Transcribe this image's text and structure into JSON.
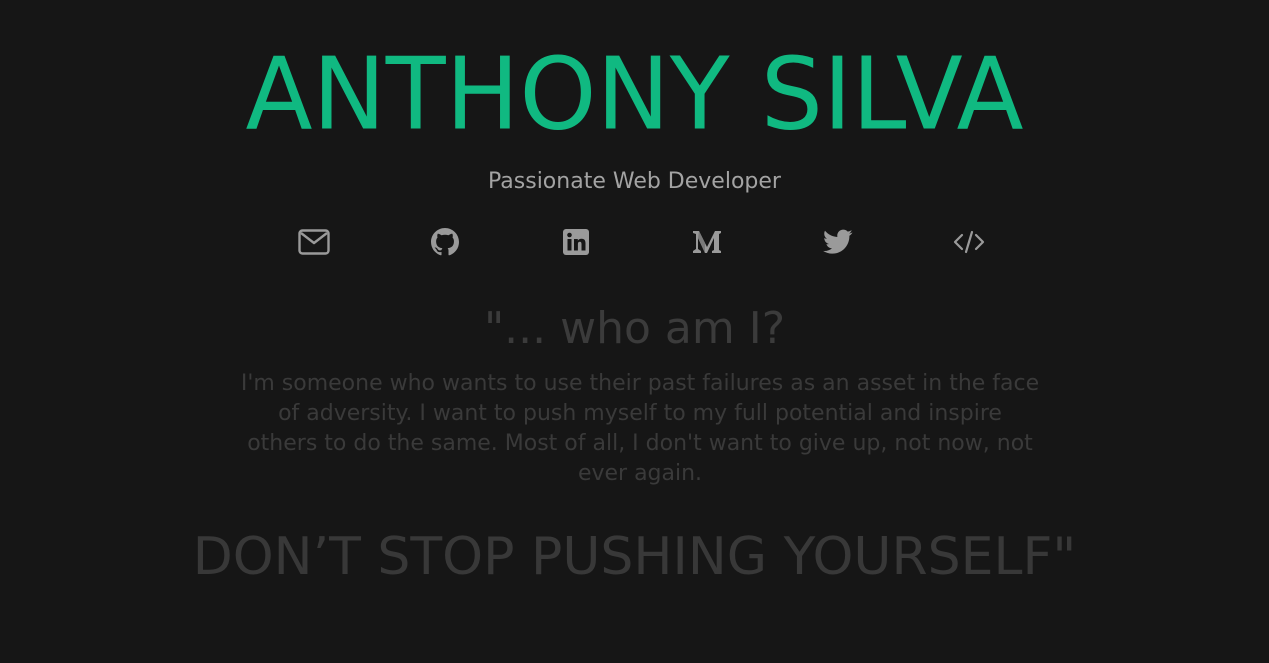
{
  "header": {
    "name": "ANTHONY SILVA",
    "tagline": "Passionate Web Developer"
  },
  "social": [
    {
      "icon": "envelope-icon",
      "label": "Email"
    },
    {
      "icon": "github-icon",
      "label": "GitHub"
    },
    {
      "icon": "linkedin-icon",
      "label": "LinkedIn"
    },
    {
      "icon": "medium-icon",
      "label": "Medium"
    },
    {
      "icon": "twitter-icon",
      "label": "Twitter"
    },
    {
      "icon": "code-icon",
      "label": "Code"
    }
  ],
  "quote": {
    "question": "\"... who am I?",
    "body": "I'm someone who wants to use their past failures as an asset in the face of adversity. I want to push myself to my full potential and inspire others to do the same. Most of all, I don't want to give up, not now, not ever again.",
    "motto": "DON’T STOP PUSHING YOURSELF\""
  },
  "colors": {
    "background": "#161616",
    "accent": "#10b981",
    "tagline": "#a3a3a3",
    "icon": "#9a9a9a",
    "quote": "#3a3a3a"
  }
}
